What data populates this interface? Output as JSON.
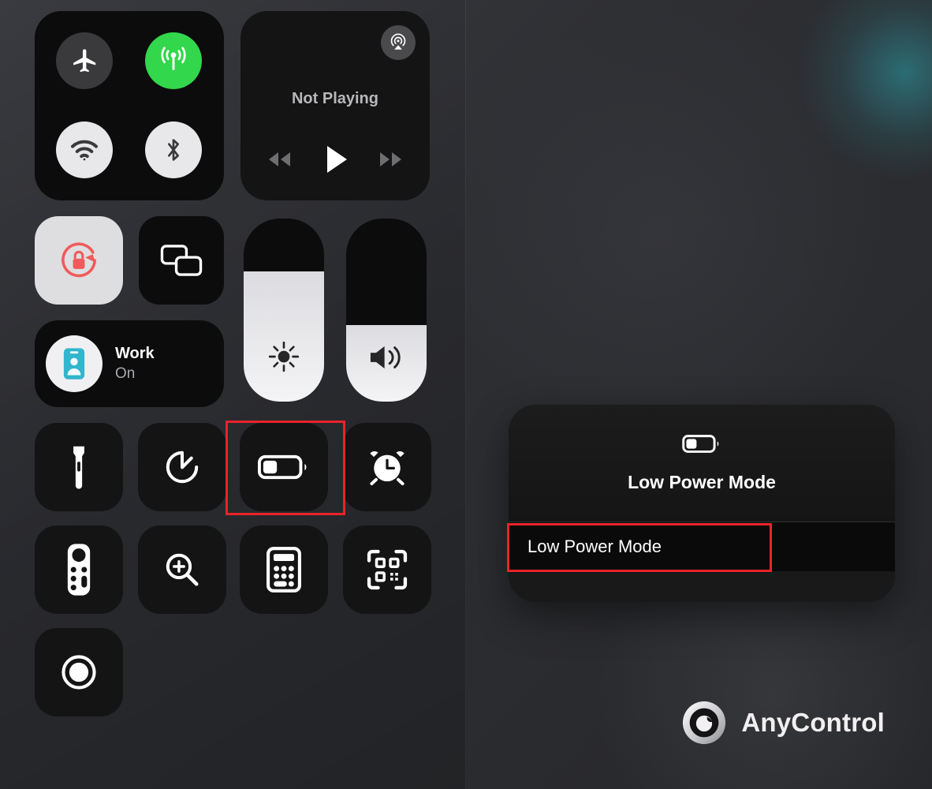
{
  "app": {
    "watermark_label": "AnyControl"
  },
  "control_center": {
    "connectivity": {
      "buttons": [
        {
          "name": "airplane-mode",
          "icon": "airplane-icon",
          "state": "off"
        },
        {
          "name": "cellular-data",
          "icon": "cellular-icon",
          "state": "on"
        },
        {
          "name": "wifi",
          "icon": "wifi-icon",
          "state": "on"
        },
        {
          "name": "bluetooth",
          "icon": "bluetooth-icon",
          "state": "on"
        }
      ]
    },
    "media": {
      "status_label": "Not Playing",
      "airplay_icon": "airplay-audio-icon",
      "controls": [
        {
          "name": "rewind-button",
          "icon": "rewind-icon"
        },
        {
          "name": "play-button",
          "icon": "play-icon"
        },
        {
          "name": "fast-forward-button",
          "icon": "fast-forward-icon"
        }
      ]
    },
    "rotation_lock": {
      "icon": "rotation-lock-icon",
      "state": "on"
    },
    "screen_mirroring": {
      "icon": "screen-mirroring-icon",
      "state": "off"
    },
    "focus": {
      "name": "Work",
      "state": "On",
      "icon": "work-badge-icon"
    },
    "sliders": [
      {
        "name": "brightness-slider",
        "icon": "brightness-icon",
        "value_percent": 71
      },
      {
        "name": "volume-slider",
        "icon": "volume-icon",
        "value_percent": 42
      }
    ],
    "grid": [
      {
        "name": "flashlight",
        "icon": "flashlight-icon"
      },
      {
        "name": "timer",
        "icon": "timer-icon"
      },
      {
        "name": "low-power-mode",
        "icon": "battery-low-power-icon"
      },
      {
        "name": "alarm",
        "icon": "alarm-clock-icon"
      },
      {
        "name": "apple-tv-remote",
        "icon": "remote-icon"
      },
      {
        "name": "magnifier",
        "icon": "magnifier-icon"
      },
      {
        "name": "calculator",
        "icon": "calculator-icon"
      },
      {
        "name": "code-scanner",
        "icon": "qr-scanner-icon"
      },
      {
        "name": "screen-recording",
        "icon": "record-icon"
      }
    ]
  },
  "popup": {
    "icon": "battery-low-power-icon",
    "title": "Low Power Mode",
    "menu_items": [
      {
        "label": "Low Power Mode",
        "highlighted": true
      }
    ]
  },
  "highlights": {
    "grid_target": "low-power-mode-tile",
    "menu_target": "low-power-mode-menu-item",
    "color": "#e8232a"
  },
  "colors": {
    "accent_green": "#32d74b",
    "accent_red": "#f05a5a",
    "accent_teal": "#32b5cd",
    "tile_dark": "#141415",
    "tile_light": "#dedee0",
    "highlight": "#e8232a"
  }
}
